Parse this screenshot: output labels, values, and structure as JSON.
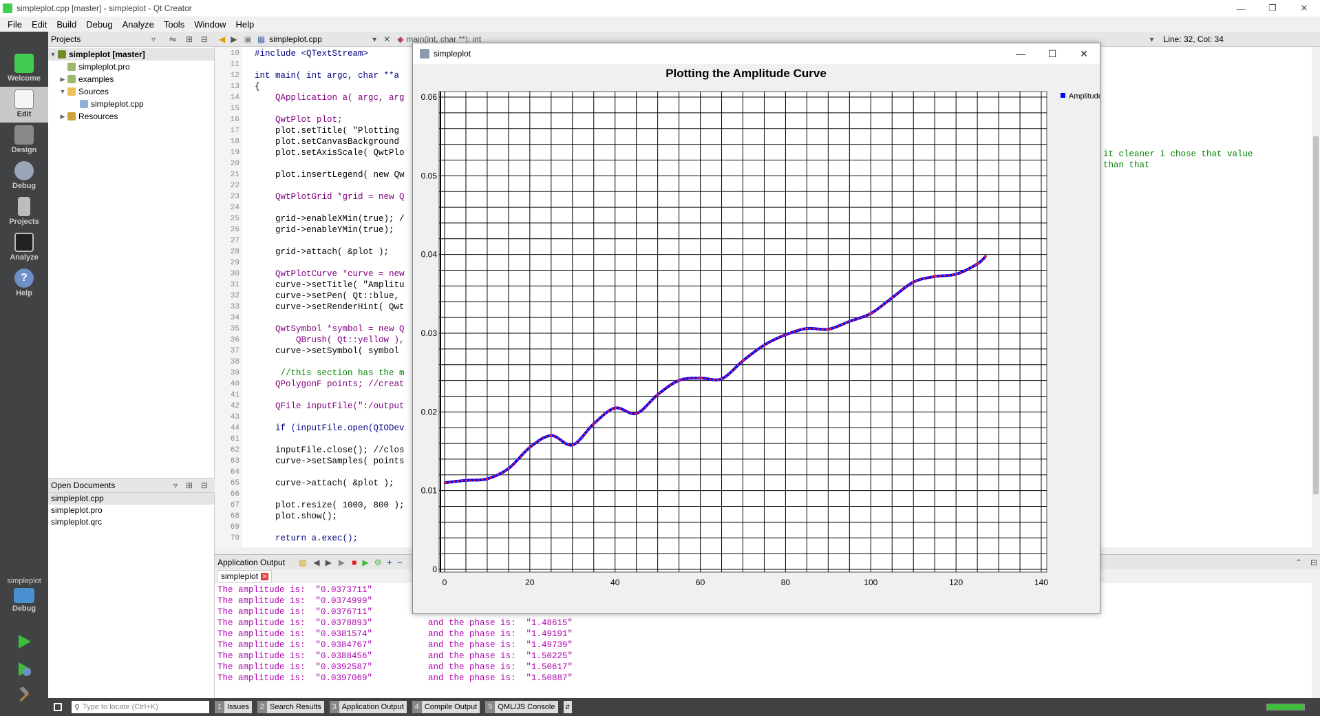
{
  "window": {
    "title": "simpleplot.cpp [master] - simpleplot - Qt Creator"
  },
  "menu": [
    "File",
    "Edit",
    "Build",
    "Debug",
    "Analyze",
    "Tools",
    "Window",
    "Help"
  ],
  "modes": [
    "Welcome",
    "Edit",
    "Design",
    "Debug",
    "Projects",
    "Analyze",
    "Help"
  ],
  "kit": {
    "project": "simpleplot",
    "mode": "Debug"
  },
  "projects": {
    "header": "Projects",
    "tree": [
      {
        "label": "simpleplot [master]",
        "bold": true
      },
      {
        "label": "simpleplot.pro"
      },
      {
        "label": "examples"
      },
      {
        "label": "Sources"
      },
      {
        "label": "simpleplot.cpp"
      },
      {
        "label": "Resources"
      }
    ]
  },
  "open_documents": {
    "header": "Open Documents",
    "items": [
      "simpleplot.cpp",
      "simpleplot.pro",
      "simpleplot.qrc"
    ]
  },
  "editor": {
    "file_tab": "simpleplot.cpp",
    "function": "main(int, char **): int",
    "position": "Line: 32, Col: 34",
    "lines": [
      {
        "n": "10",
        "code": "#include <QTextStream>"
      },
      {
        "n": "11",
        "code": ""
      },
      {
        "n": "12",
        "code": "int main( int argc, char **a"
      },
      {
        "n": "13",
        "code": "{"
      },
      {
        "n": "14",
        "code": "    QApplication a( argc, arg"
      },
      {
        "n": "15",
        "code": ""
      },
      {
        "n": "16",
        "code": "    QwtPlot plot;"
      },
      {
        "n": "17",
        "code": "    plot.setTitle( \"Plotting"
      },
      {
        "n": "18",
        "code": "    plot.setCanvasBackground"
      },
      {
        "n": "19",
        "code": "    plot.setAxisScale( QwtPlo"
      },
      {
        "n": "20",
        "code": ""
      },
      {
        "n": "21",
        "code": "    plot.insertLegend( new Qw"
      },
      {
        "n": "22",
        "code": ""
      },
      {
        "n": "23",
        "code": "    QwtPlotGrid *grid = new Q"
      },
      {
        "n": "24",
        "code": ""
      },
      {
        "n": "25",
        "code": "    grid->enableXMin(true); /"
      },
      {
        "n": "26",
        "code": "    grid->enableYMin(true);"
      },
      {
        "n": "27",
        "code": ""
      },
      {
        "n": "28",
        "code": "    grid->attach( &plot );"
      },
      {
        "n": "29",
        "code": ""
      },
      {
        "n": "30",
        "code": "    QwtPlotCurve *curve = new"
      },
      {
        "n": "31",
        "code": "    curve->setTitle( \"Amplitu"
      },
      {
        "n": "32",
        "code": "    curve->setPen( Qt::blue,"
      },
      {
        "n": "33",
        "code": "    curve->setRenderHint( Qwt"
      },
      {
        "n": "34",
        "code": ""
      },
      {
        "n": "35",
        "code": "    QwtSymbol *symbol = new Q"
      },
      {
        "n": "36",
        "code": "        QBrush( Qt::yellow ),"
      },
      {
        "n": "37",
        "code": "    curve->setSymbol( symbol"
      },
      {
        "n": "38",
        "code": ""
      },
      {
        "n": "39",
        "code": "     //this section has the m"
      },
      {
        "n": "40",
        "code": "    QPolygonF points; //creat"
      },
      {
        "n": "41",
        "code": ""
      },
      {
        "n": "42",
        "code": "    QFile inputFile(\":/output"
      },
      {
        "n": "43",
        "code": ""
      },
      {
        "n": "44",
        "code": "    if (inputFile.open(QIODev"
      },
      {
        "n": "61",
        "code": ""
      },
      {
        "n": "62",
        "code": "    inputFile.close(); //clos"
      },
      {
        "n": "63",
        "code": "    curve->setSamples( points"
      },
      {
        "n": "64",
        "code": ""
      },
      {
        "n": "65",
        "code": "    curve->attach( &plot );"
      },
      {
        "n": "66",
        "code": ""
      },
      {
        "n": "67",
        "code": "    plot.resize( 1000, 800 );"
      },
      {
        "n": "68",
        "code": "    plot.show();"
      },
      {
        "n": "69",
        "code": ""
      },
      {
        "n": "70",
        "code": "    return a.exec();"
      }
    ],
    "right_comments": [
      "e it cleaner i chose that value",
      ": than that"
    ]
  },
  "output": {
    "header": "Application Output",
    "tab": "simpleplot",
    "lines": [
      {
        "amp": "The amplitude is:  \"0.0373711\"",
        "phase": ""
      },
      {
        "amp": "The amplitude is:  \"0.0374999\"",
        "phase": ""
      },
      {
        "amp": "The amplitude is:  \"0.0376711\"",
        "phase": ""
      },
      {
        "amp": "The amplitude is:  \"0.0378893\"",
        "phase": "and the phase is:  \"1.48615\""
      },
      {
        "amp": "The amplitude is:  \"0.0381574\"",
        "phase": "and the phase is:  \"1.49191\""
      },
      {
        "amp": "The amplitude is:  \"0.0384767\"",
        "phase": "and the phase is:  \"1.49739\""
      },
      {
        "amp": "The amplitude is:  \"0.0388456\"",
        "phase": "and the phase is:  \"1.50225\""
      },
      {
        "amp": "The amplitude is:  \"0.0392587\"",
        "phase": "and the phase is:  \"1.50617\""
      },
      {
        "amp": "The amplitude is:  \"0.0397069\"",
        "phase": "and the phase is:  \"1.50887\""
      }
    ]
  },
  "statusbar": {
    "locate_placeholder": "Type to locate (Ctrl+K)",
    "tabs": [
      {
        "num": "1",
        "label": "Issues"
      },
      {
        "num": "2",
        "label": "Search Results"
      },
      {
        "num": "3",
        "label": "Application Output"
      },
      {
        "num": "4",
        "label": "Compile Output"
      },
      {
        "num": "5",
        "label": "QML/JS Console"
      }
    ]
  },
  "plot_window": {
    "title": "simpleplot"
  },
  "chart_data": {
    "type": "line",
    "title": "Plotting the Amplitude Curve",
    "xlabel": "",
    "ylabel": "",
    "xlim": [
      0,
      140
    ],
    "ylim": [
      0,
      0.06
    ],
    "x_ticks": [
      "0",
      "20",
      "40",
      "60",
      "80",
      "100",
      "120",
      "140"
    ],
    "y_ticks": [
      "0",
      "0.01",
      "0.02",
      "0.03",
      "0.04",
      "0.05",
      "0.06"
    ],
    "grid": true,
    "legend": "right",
    "series": [
      {
        "name": "Amplitudes",
        "color": "#0000ff",
        "x": [
          0,
          5,
          10,
          15,
          20,
          25,
          30,
          35,
          40,
          45,
          50,
          55,
          60,
          65,
          70,
          75,
          80,
          85,
          90,
          95,
          100,
          105,
          110,
          115,
          120,
          125,
          127
        ],
        "values": [
          0.011,
          0.0113,
          0.0115,
          0.0128,
          0.0155,
          0.017,
          0.0158,
          0.0185,
          0.0205,
          0.0198,
          0.0222,
          0.024,
          0.0243,
          0.0242,
          0.0265,
          0.0285,
          0.0298,
          0.0306,
          0.0305,
          0.0315,
          0.0325,
          0.0345,
          0.0365,
          0.0372,
          0.0375,
          0.0388,
          0.0398
        ]
      }
    ]
  }
}
